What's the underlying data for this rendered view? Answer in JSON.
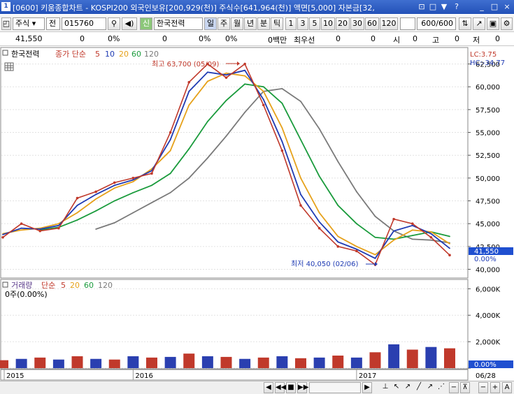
{
  "window": {
    "app_icon": "1",
    "title": "[0600] 키움종합차트 - KOSPI200 외국인보유[200,929(천)] 주식수[641,964(천)] 액면[5,000] 자본금[32,",
    "controls": [
      "restore-icon",
      "pin-icon",
      "help-icon",
      "minimize-icon",
      "maximize-icon",
      "close-icon"
    ],
    "control_glyphs": [
      "⊡",
      "□",
      "▼",
      "?",
      "_",
      "□",
      "×"
    ]
  },
  "toolbar": {
    "market": "주식",
    "range": "전",
    "code": "015760",
    "stock_badge": "신",
    "stock_name": "한국전력",
    "periods": [
      "일",
      "주",
      "월",
      "년",
      "분",
      "틱"
    ],
    "selected_period": "일",
    "intervals": [
      "1",
      "3",
      "5",
      "10",
      "20",
      "30",
      "60",
      "120"
    ],
    "count": "600",
    "count_total": "/600"
  },
  "quote": {
    "price": "41,550",
    "change": "0",
    "change_pct": "0%",
    "v1": "0",
    "v1_pct": "0%",
    "v2_pct": "0%",
    "amount": "0백만",
    "best_label": "최우선",
    "best1": "0",
    "best2": "0",
    "open_label": "시",
    "open": "0",
    "high_label": "고",
    "high": "0",
    "low_label": "저",
    "low": "0"
  },
  "price_panel": {
    "legend_name": "한국전력",
    "legend_type": "종가 단순",
    "ma_labels": [
      "5",
      "10",
      "20",
      "60",
      "120"
    ],
    "ma_colors": [
      "#c0392b",
      "#1f3bb3",
      "#e6a11a",
      "#1a9b3c",
      "#7a7a7a"
    ],
    "lc_label": "LC:3.75",
    "hc_label": "HC:-34.77",
    "y_ticks": [
      62500,
      60000,
      57500,
      55000,
      52500,
      50000,
      47500,
      45000,
      42500,
      40000
    ],
    "y_tick_labels": [
      "62,500",
      "60,000",
      "57,500",
      "55,000",
      "52,500",
      "50,000",
      "47,500",
      "45,000",
      "42,500",
      "40,000"
    ],
    "last_price_label": "41,550",
    "pct_label": "0.00%",
    "high_annotation": "최고 63,700 (05/09)",
    "low_annotation": "최저 40,050 (02/06)"
  },
  "volume_panel": {
    "legend_name": "거래량",
    "legend_type": "단순",
    "ma_labels": [
      "5",
      "20",
      "60",
      "120"
    ],
    "ma_colors": [
      "#c0392b",
      "#e6a11a",
      "#1a9b3c",
      "#7a7a7a"
    ],
    "current": "0주(0.00%)",
    "y_ticks": [
      6000,
      4000,
      2000,
      0
    ],
    "y_tick_labels": [
      "6,000K",
      "4,000K",
      "2,000K",
      "0"
    ],
    "zero_label": "0.00%"
  },
  "x_axis": {
    "labels": [
      "2015",
      "2016",
      "2017"
    ],
    "right_label": "06/28"
  },
  "chart_data": {
    "type": "line",
    "stock": "한국전력",
    "ylim": [
      39500,
      64000
    ],
    "x": [
      "2015-06",
      "2015-07",
      "2015-08",
      "2015-09",
      "2015-10",
      "2015-11",
      "2015-12",
      "2016-01",
      "2016-02",
      "2016-03",
      "2016-04",
      "2016-05",
      "2016-06",
      "2016-07",
      "2016-08",
      "2016-09",
      "2016-10",
      "2016-11",
      "2016-12",
      "2017-01",
      "2017-02",
      "2017-03",
      "2017-04",
      "2017-05",
      "2017-06"
    ],
    "series": [
      {
        "values": [
          43500,
          45000,
          44200,
          44500,
          47800,
          48500,
          49500,
          50000,
          50500,
          55000,
          60500,
          62500,
          61000,
          62500,
          58000,
          53000,
          47000,
          44500,
          42500,
          42000,
          40500,
          45500,
          45000,
          43500,
          41550
        ]
      },
      {
        "values": [
          43800,
          44500,
          44400,
          44800,
          47000,
          48200,
          49200,
          49800,
          50800,
          54200,
          59500,
          61600,
          61300,
          61800,
          58600,
          54000,
          48200,
          45200,
          43000,
          42200,
          41200,
          44200,
          44800,
          43900,
          42300
        ]
      },
      {
        "values": [
          43900,
          44300,
          44500,
          45000,
          46200,
          47700,
          48900,
          49600,
          51000,
          53000,
          58000,
          60600,
          61500,
          61200,
          59500,
          55500,
          50000,
          46200,
          43600,
          42500,
          41600,
          43200,
          44300,
          44100,
          42800
        ]
      },
      {
        "values": [
          null,
          null,
          44300,
          44600,
          45400,
          46400,
          47500,
          48400,
          49200,
          50500,
          53200,
          56200,
          58500,
          60300,
          60000,
          58200,
          54200,
          50200,
          47000,
          45000,
          43500,
          43300,
          43700,
          44100,
          43600
        ]
      },
      {
        "values": [
          null,
          null,
          null,
          null,
          null,
          44400,
          45100,
          46200,
          47300,
          48400,
          50000,
          52200,
          54600,
          57200,
          59500,
          59800,
          58400,
          55400,
          51800,
          48500,
          45800,
          44200,
          43300,
          43200,
          42900
        ]
      }
    ],
    "volume_unit": "K",
    "volume_ylim": [
      0,
      6600
    ],
    "volume": [
      600,
      700,
      800,
      650,
      900,
      700,
      650,
      900,
      800,
      850,
      1100,
      900,
      850,
      700,
      800,
      900,
      750,
      800,
      950,
      800,
      1200,
      1800,
      1400,
      1600,
      1500
    ]
  }
}
